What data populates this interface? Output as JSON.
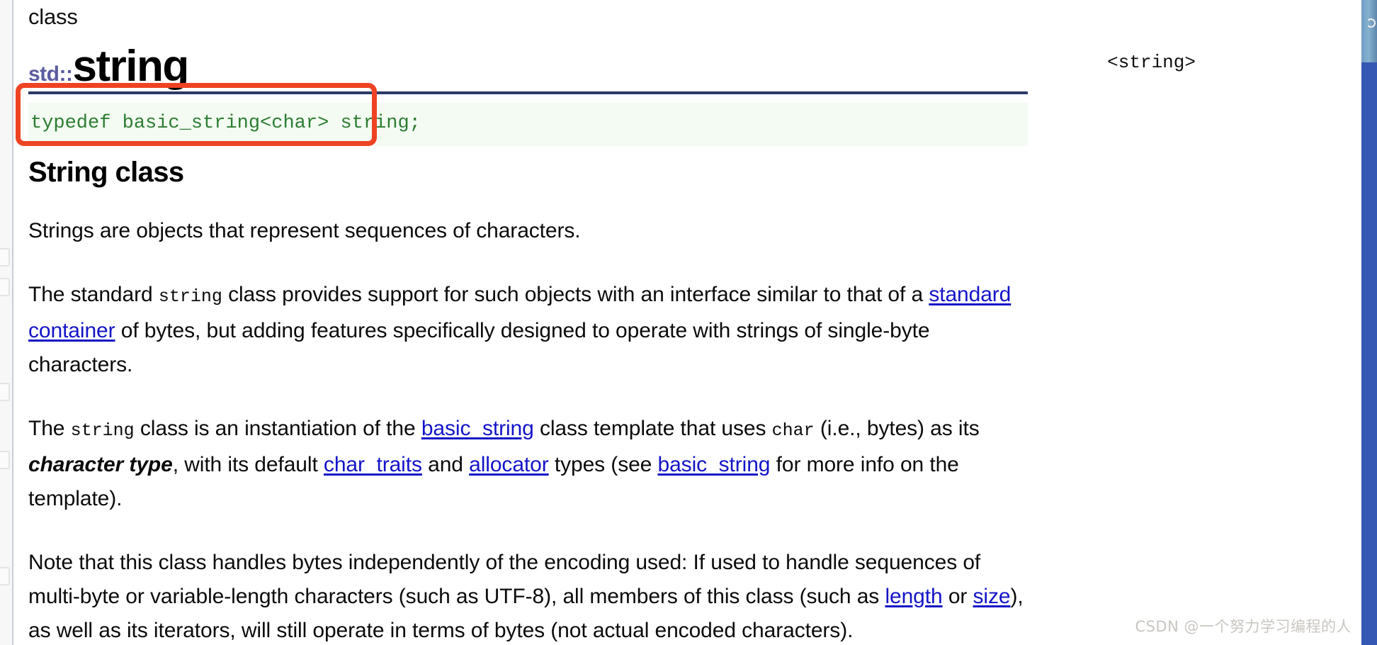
{
  "page": {
    "kind_label": "class",
    "namespace_prefix": "std::",
    "class_name": "string",
    "header_include": "<string>"
  },
  "code_block": {
    "declaration": "typedef basic_string<char> string;"
  },
  "section": {
    "title": "String class"
  },
  "paragraphs": {
    "p1": {
      "text": "Strings are objects that represent sequences of characters."
    },
    "p2": {
      "seg1": "The standard ",
      "code1": "string",
      "seg2": " class provides support for such objects with an interface similar to that of a ",
      "link1": "standard container",
      "seg3": " of bytes, but adding features specifically designed to operate with strings of single-byte characters."
    },
    "p3": {
      "seg1": "The ",
      "code1": "string",
      "seg2": " class is an instantiation of the ",
      "link1": "basic_string",
      "seg3": " class template that uses ",
      "code2": "char",
      "seg4": " (i.e., bytes) as its ",
      "emphasis": "character type",
      "seg5": ", with its default ",
      "link2": "char_traits",
      "seg6": " and ",
      "link3": "allocator",
      "seg7": " types (see ",
      "link4": "basic_string",
      "seg8": " for more info on the template)."
    },
    "p4": {
      "seg1": "Note that this class handles bytes independently of the encoding used: If used to handle sequences of multi-byte or variable-length characters (such as UTF-8), all members of this class (such as ",
      "link1": "length",
      "seg2": " or ",
      "link2": "size",
      "seg3": "), as well as its iterators, will still operate in terms of bytes (not actual encoded characters)."
    }
  },
  "annotation": {
    "shape": "red-rounded-rectangle",
    "color": "#ee4323",
    "target": "typedef basic_string<char> string;"
  },
  "watermark": {
    "text": "CSDN @一个努力学习编程的人"
  },
  "colors": {
    "namespace_purple": "#5b5ba0",
    "rule_navy": "#2b3a67",
    "code_green": "#2e7d32",
    "code_background": "#f3fbf3",
    "link_blue": "#1414c8",
    "annotation_red": "#ee4323",
    "right_strip_blue": "#3558b4",
    "watermark_gray": "#c9c6c1"
  }
}
